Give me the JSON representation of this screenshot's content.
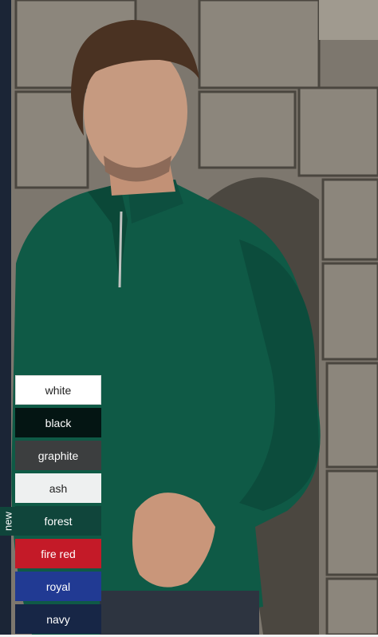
{
  "product": {
    "colors": [
      {
        "label": "white",
        "hex": "#ffffff"
      },
      {
        "label": "black",
        "hex": "#041513"
      },
      {
        "label": "graphite",
        "hex": "#3c3e3f"
      },
      {
        "label": "ash",
        "hex": "#eef0f0"
      },
      {
        "label": "forest",
        "hex": "#10453b"
      },
      {
        "label": "fire red",
        "hex": "#c41a28"
      },
      {
        "label": "royal",
        "hex": "#213a93"
      },
      {
        "label": "navy",
        "hex": "#172646"
      }
    ],
    "new_badge": "new"
  },
  "image": {
    "description_icon": "model-photo"
  }
}
